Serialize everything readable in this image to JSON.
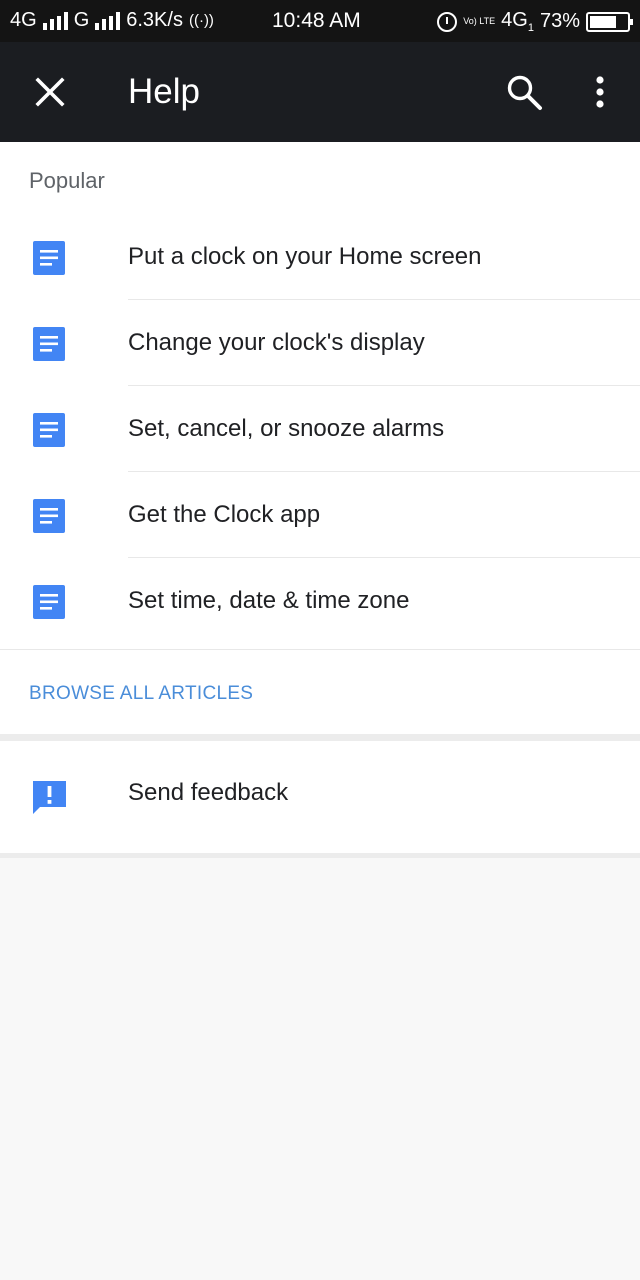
{
  "status_bar": {
    "network1": "4G",
    "network2": "G",
    "speed": "6.3K/s",
    "time": "10:48 AM",
    "volte": "Vo) LTE",
    "network3": "4G",
    "network3_sub": "1",
    "battery": "73%",
    "battery_level": 0.73
  },
  "app_bar": {
    "title": "Help",
    "close_icon": "close-icon",
    "search_icon": "search-icon",
    "more_icon": "more-vert-icon"
  },
  "popular": {
    "heading": "Popular",
    "articles": [
      {
        "label": "Put a clock on your Home screen",
        "icon": "document-icon"
      },
      {
        "label": "Change your clock's display",
        "icon": "document-icon"
      },
      {
        "label": "Set, cancel, or snooze alarms",
        "icon": "document-icon"
      },
      {
        "label": "Get the Clock app",
        "icon": "document-icon"
      },
      {
        "label": "Set time, date & time zone",
        "icon": "document-icon"
      }
    ],
    "browse_all": "BROWSE ALL ARTICLES"
  },
  "feedback": {
    "label": "Send feedback",
    "icon": "feedback-icon"
  },
  "colors": {
    "appbar": "#1b1d21",
    "accent_blue": "#4285f4",
    "link_blue": "#4a8dd9"
  }
}
